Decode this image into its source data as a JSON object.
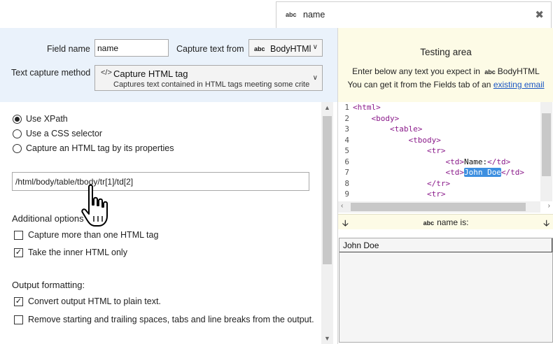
{
  "tab": {
    "icon_label": "abc",
    "name": "name",
    "close_glyph": "✖"
  },
  "config": {
    "field_name_label": "Field name",
    "field_name_value": "name",
    "capture_from_label": "Capture text from",
    "capture_from_icon": "abc",
    "capture_from_value": "BodyHTMl",
    "method_label": "Text capture method",
    "method_icon": "</>",
    "method_title": "Capture HTML tag",
    "method_desc": "Captures text contained in HTML tags meeting some crite"
  },
  "selectors": [
    {
      "label": "Use XPath",
      "selected": true
    },
    {
      "label": "Use a CSS selector",
      "selected": false
    },
    {
      "label": "Capture an HTML tag by its properties",
      "selected": false
    }
  ],
  "xpath_value": "/html/body/table/tbody/tr[1]/td[2]",
  "additional": {
    "title": "Additional options",
    "options": [
      {
        "label": "Capture more than one HTML tag",
        "checked": false
      },
      {
        "label": "Take the inner HTML only",
        "checked": true
      }
    ]
  },
  "output": {
    "title": "Output formatting:",
    "options": [
      {
        "label": "Convert output HTML to plain text.",
        "checked": true
      },
      {
        "label": "Remove starting and trailing spaces, tabs and line breaks from the output.",
        "checked": false
      }
    ]
  },
  "testing": {
    "title": "Testing area",
    "line1_pre": "Enter below any text you expect in",
    "line1_icon": "abc",
    "line1_field": "BodyHTML",
    "line2_pre": "You can get it from the Fields tab of an",
    "line2_link": "existing email",
    "code_lines": [
      {
        "num": "1",
        "indent": "",
        "pre": "<html>",
        "hl": "",
        "post": ""
      },
      {
        "num": "2",
        "indent": "    ",
        "pre": "<body>",
        "hl": "",
        "post": ""
      },
      {
        "num": "3",
        "indent": "        ",
        "pre": "<table>",
        "hl": "",
        "post": ""
      },
      {
        "num": "4",
        "indent": "            ",
        "pre": "<tbody>",
        "hl": "",
        "post": ""
      },
      {
        "num": "5",
        "indent": "                ",
        "pre": "<tr>",
        "hl": "",
        "post": ""
      },
      {
        "num": "6",
        "indent": "                    ",
        "pre": "<td>",
        "hl": "",
        "text": "Name:",
        "post": "</td>"
      },
      {
        "num": "7",
        "indent": "                    ",
        "pre": "<td>",
        "hl": "John Doe",
        "post": "</td>"
      },
      {
        "num": "8",
        "indent": "                ",
        "pre": "</tr>",
        "hl": "",
        "post": ""
      },
      {
        "num": "9",
        "indent": "                ",
        "pre": "<tr>",
        "hl": "",
        "post": ""
      }
    ],
    "result_label_icon": "abc",
    "result_label": "name is:",
    "result_value": "John Doe"
  }
}
